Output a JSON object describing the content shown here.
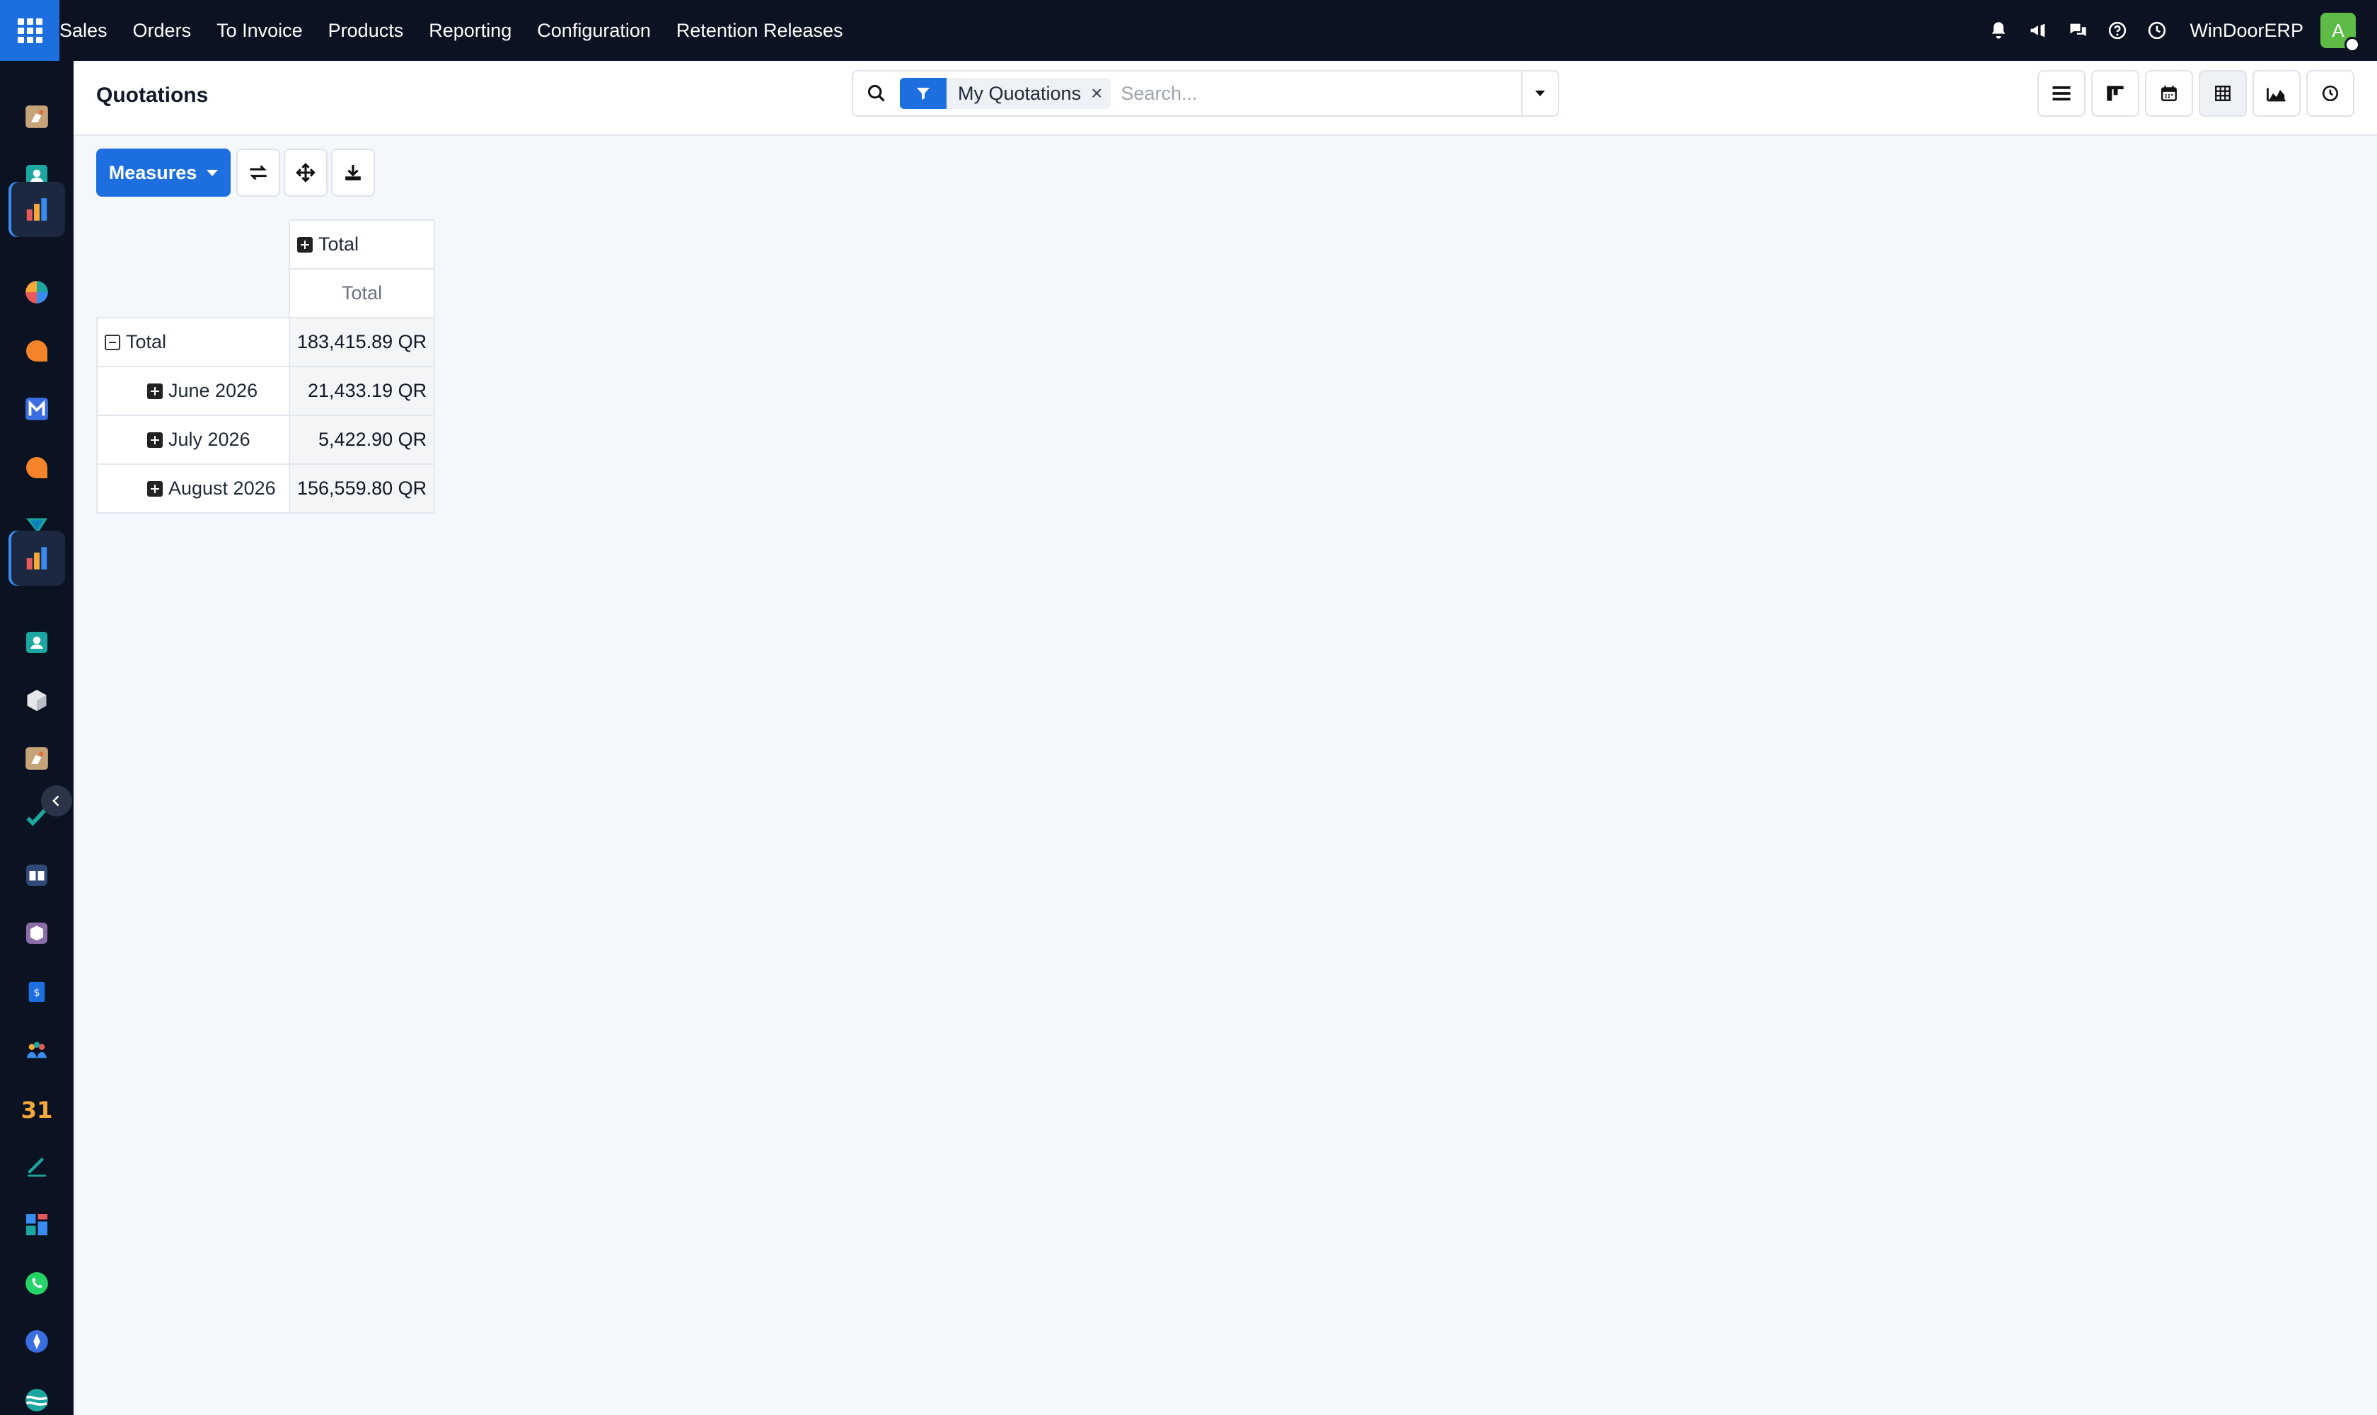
{
  "nav": {
    "menu": [
      "Sales",
      "Orders",
      "To Invoice",
      "Products",
      "Reporting",
      "Configuration",
      "Retention Releases"
    ],
    "company": "WinDoorERP",
    "avatar_initial": "A"
  },
  "dock": {
    "calendar_day": "31"
  },
  "control_panel": {
    "title": "Quotations",
    "facet": "My Quotations",
    "facet_remove": "×",
    "search_placeholder": "Search..."
  },
  "actions": {
    "measures_label": "Measures"
  },
  "pivot": {
    "col_header": "Total",
    "measure_header": "Total",
    "rows": [
      {
        "label": "Total",
        "value": "183,415.89 QR"
      },
      {
        "label": "June 2026",
        "value": "21,433.19 QR"
      },
      {
        "label": "July 2026",
        "value": "5,422.90 QR"
      },
      {
        "label": "August 2026",
        "value": "156,559.80 QR"
      }
    ]
  },
  "colors": {
    "primary": "#1d6fe0",
    "navbar": "#0b1222",
    "avatar": "#5dbb46"
  }
}
